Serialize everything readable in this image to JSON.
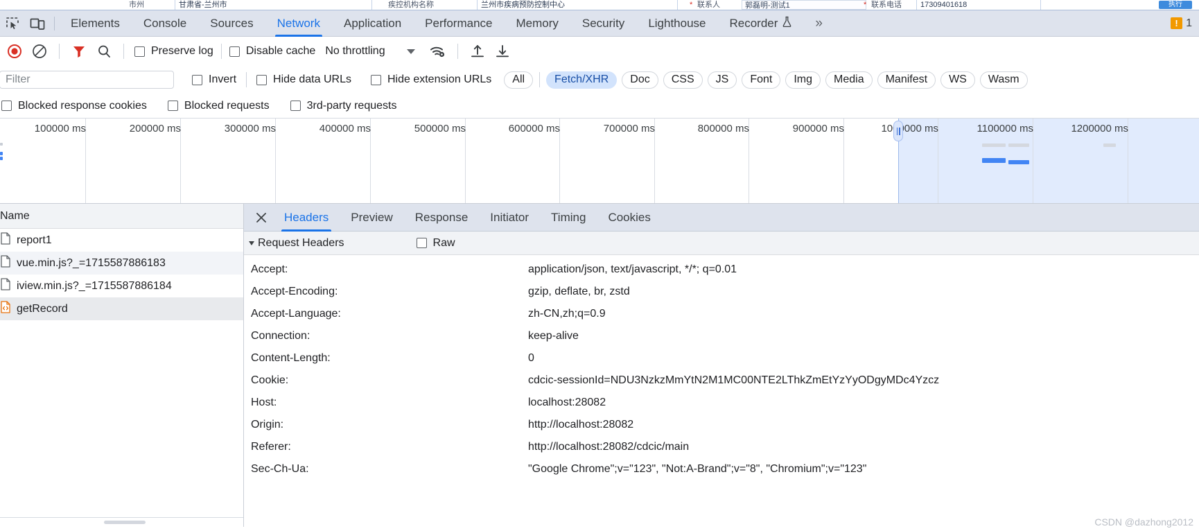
{
  "page_background": {
    "fields": [
      {
        "label": "市州",
        "value": "甘肃省-兰州市"
      },
      {
        "label": "疾控机构名称",
        "value": "兰州市疾病预防控制中心"
      },
      {
        "label": "联系人",
        "value": "郭磊明-测试1",
        "required": true
      },
      {
        "label": "联系电话",
        "value": "17309401618",
        "required": true
      }
    ],
    "submit_label": "执行"
  },
  "devtools": {
    "toolbar_icons": {
      "inspect": "inspect-element-icon",
      "device": "device-toolbar-icon"
    },
    "tabs": [
      {
        "label": "Elements",
        "active": false
      },
      {
        "label": "Console",
        "active": false
      },
      {
        "label": "Sources",
        "active": false
      },
      {
        "label": "Network",
        "active": true
      },
      {
        "label": "Application",
        "active": false
      },
      {
        "label": "Performance",
        "active": false
      },
      {
        "label": "Memory",
        "active": false
      },
      {
        "label": "Security",
        "active": false
      },
      {
        "label": "Lighthouse",
        "active": false
      },
      {
        "label": "Recorder",
        "active": false,
        "experimental": true
      }
    ],
    "more_tabs_label": "»",
    "warnings_count": "1",
    "warning_color": "#f29900",
    "accent_color": "#1a73e8"
  },
  "network_toolbar": {
    "record_label": "record-button",
    "record_active": true,
    "record_color": "#d93025",
    "clear_label": "clear-button",
    "filter_label": "filter-button",
    "filter_active": true,
    "search_label": "search-button",
    "preserve_log": {
      "label": "Preserve log",
      "checked": false
    },
    "disable_cache": {
      "label": "Disable cache",
      "checked": false
    },
    "throttling": {
      "value": "No throttling"
    },
    "network_conditions_label": "network-conditions-icon",
    "import_har_label": "import-har-icon",
    "export_har_label": "export-har-icon"
  },
  "filter_bar": {
    "filter_placeholder": "Filter",
    "filter_value": "",
    "invert": {
      "label": "Invert",
      "checked": false
    },
    "hide_data_urls": {
      "label": "Hide data URLs",
      "checked": false
    },
    "hide_extension_urls": {
      "label": "Hide extension URLs",
      "checked": false
    },
    "type_chips": [
      {
        "label": "All",
        "selected": false
      },
      {
        "label": "Fetch/XHR",
        "selected": true
      },
      {
        "label": "Doc",
        "selected": false
      },
      {
        "label": "CSS",
        "selected": false
      },
      {
        "label": "JS",
        "selected": false
      },
      {
        "label": "Font",
        "selected": false
      },
      {
        "label": "Img",
        "selected": false
      },
      {
        "label": "Media",
        "selected": false
      },
      {
        "label": "Manifest",
        "selected": false
      },
      {
        "label": "WS",
        "selected": false
      },
      {
        "label": "Wasm",
        "selected": false
      }
    ],
    "blocked_checks": [
      {
        "label": "Blocked response cookies",
        "checked": false
      },
      {
        "label": "Blocked requests",
        "checked": false
      },
      {
        "label": "3rd-party requests",
        "checked": false
      }
    ]
  },
  "overview": {
    "ticks": [
      "100000 ms",
      "200000 ms",
      "300000 ms",
      "400000 ms",
      "500000 ms",
      "600000 ms",
      "700000 ms",
      "800000 ms",
      "900000 ms",
      "1000000 ms",
      "1100000 ms",
      "1200000 ms"
    ],
    "selection_start_label": "1000000 ms",
    "selection_color": "#4285f4"
  },
  "request_list": {
    "column_header": "Name",
    "rows": [
      {
        "name": "report1",
        "icon": "document-icon",
        "selected": false
      },
      {
        "name": "vue.min.js?_=1715587886183",
        "icon": "document-icon",
        "selected": false
      },
      {
        "name": "iview.min.js?_=1715587886184",
        "icon": "document-icon",
        "selected": false
      },
      {
        "name": "getRecord",
        "icon": "fetch-xhr-icon",
        "selected": true
      }
    ]
  },
  "detail_pane": {
    "close_label": "close-button",
    "tabs": [
      {
        "label": "Headers",
        "active": true
      },
      {
        "label": "Preview",
        "active": false
      },
      {
        "label": "Response",
        "active": false
      },
      {
        "label": "Initiator",
        "active": false
      },
      {
        "label": "Timing",
        "active": false
      },
      {
        "label": "Cookies",
        "active": false
      }
    ],
    "section_title": "Request Headers",
    "section_expanded": true,
    "raw_toggle": {
      "label": "Raw",
      "checked": false
    },
    "headers": [
      {
        "key": "Accept:",
        "value": "application/json, text/javascript, */*; q=0.01"
      },
      {
        "key": "Accept-Encoding:",
        "value": "gzip, deflate, br, zstd"
      },
      {
        "key": "Accept-Language:",
        "value": "zh-CN,zh;q=0.9"
      },
      {
        "key": "Connection:",
        "value": "keep-alive"
      },
      {
        "key": "Content-Length:",
        "value": "0"
      },
      {
        "key": "Cookie:",
        "value": "cdcic-sessionId=NDU3NzkzMmYtN2M1MC00NTE2LThkZmEtYzYyODgyMDc4Yzcz"
      },
      {
        "key": "Host:",
        "value": "localhost:28082"
      },
      {
        "key": "Origin:",
        "value": "http://localhost:28082"
      },
      {
        "key": "Referer:",
        "value": "http://localhost:28082/cdcic/main"
      },
      {
        "key": "Sec-Ch-Ua:",
        "value": "\"Google Chrome\";v=\"123\", \"Not:A-Brand\";v=\"8\", \"Chromium\";v=\"123\""
      }
    ]
  },
  "watermark": "CSDN @dazhong2012"
}
